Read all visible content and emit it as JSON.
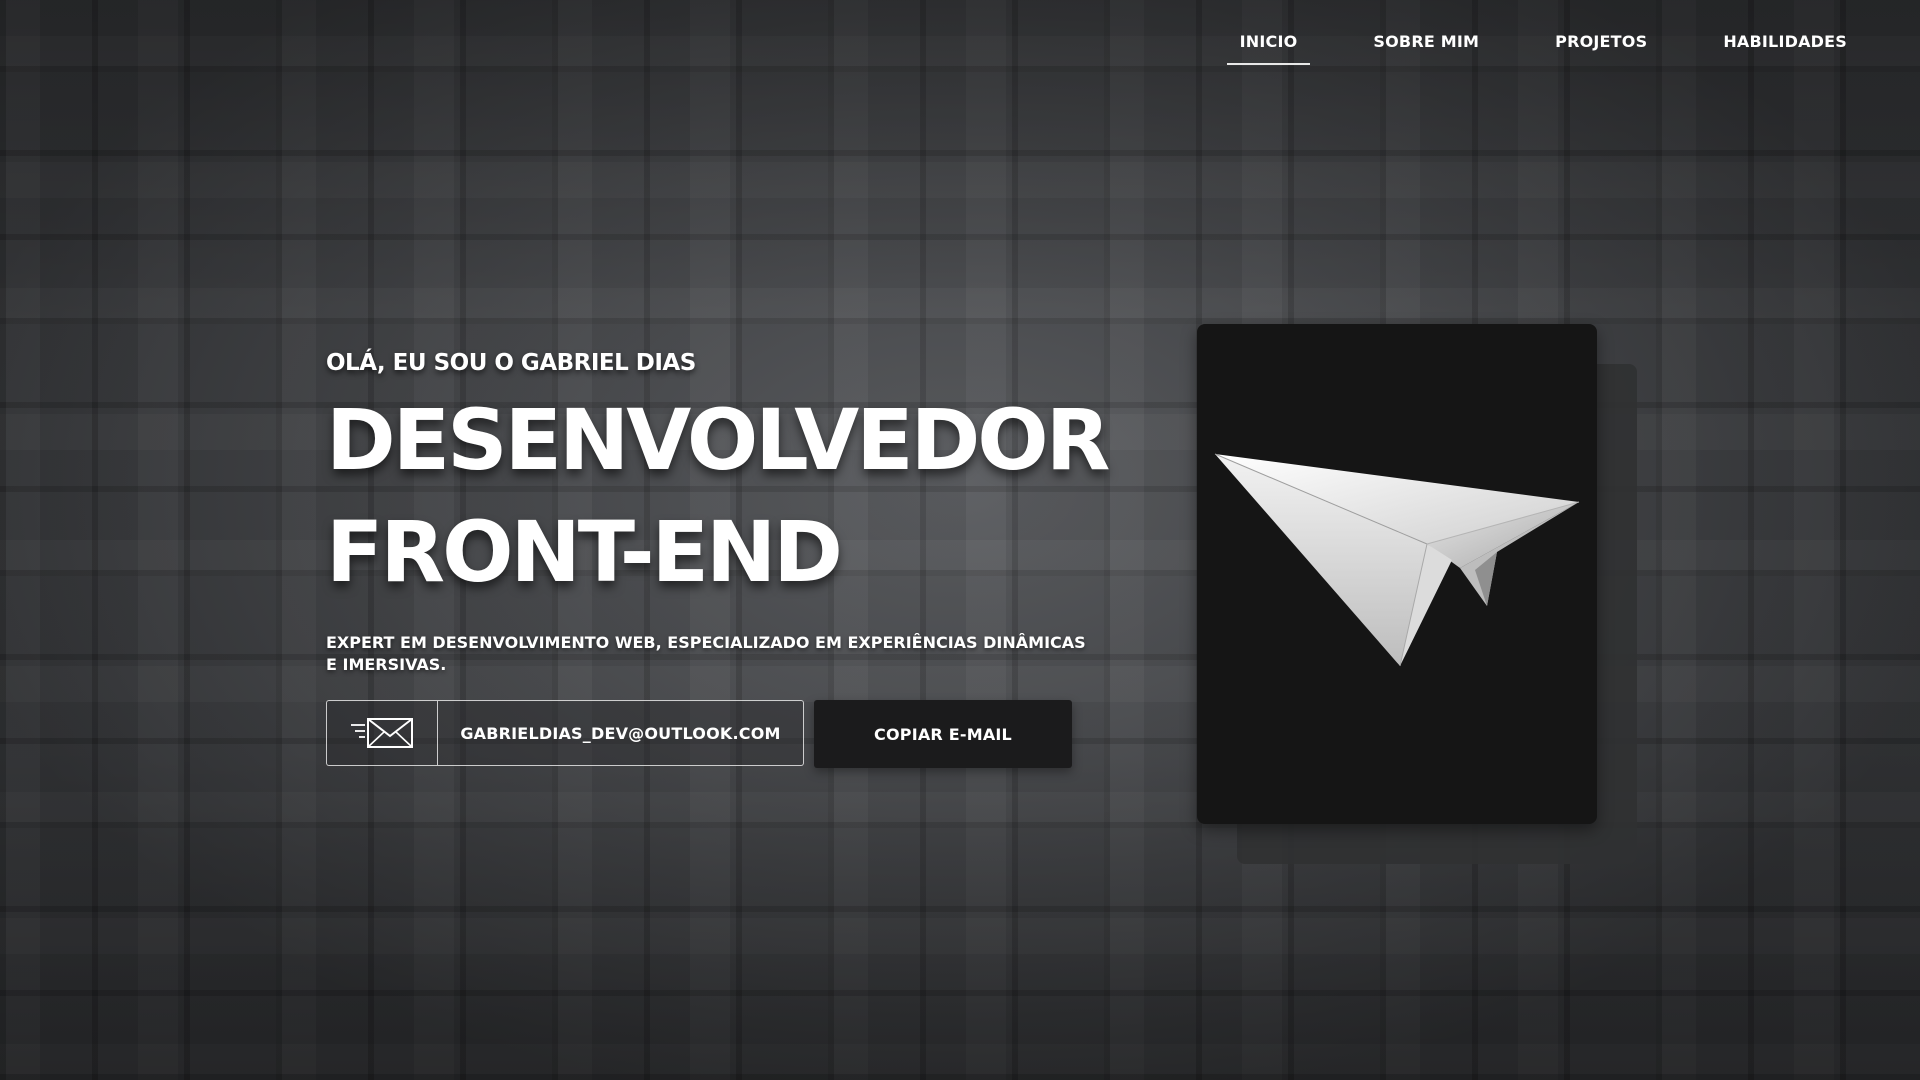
{
  "nav": {
    "items": [
      {
        "label": "INICIO",
        "active": true
      },
      {
        "label": "SOBRE MIM",
        "active": false
      },
      {
        "label": "PROJETOS",
        "active": false
      },
      {
        "label": "HABILIDADES",
        "active": false
      }
    ]
  },
  "hero": {
    "greeting": "OLÁ, EU SOU O GABRIEL DIAS",
    "headline_line1": "DESENVOLVEDOR",
    "headline_line2": "FRONT-END",
    "subtitle": "EXPERT EM DESENVOLVIMENTO WEB, ESPECIALIZADO EM EXPERIÊNCIAS DINÂMICAS E IMERSIVAS."
  },
  "contact": {
    "email": "GABRIELDIAS_DEV@OUTLOOK.COM",
    "email_icon": "mail-icon",
    "copy_button_label": "COPIAR E-MAIL"
  },
  "illustration": {
    "icon": "paper-plane-icon"
  },
  "colors": {
    "card_background": "#151515",
    "card_shadow": "#303132",
    "button_background": "#1b1b1c",
    "text": "#ffffff"
  }
}
